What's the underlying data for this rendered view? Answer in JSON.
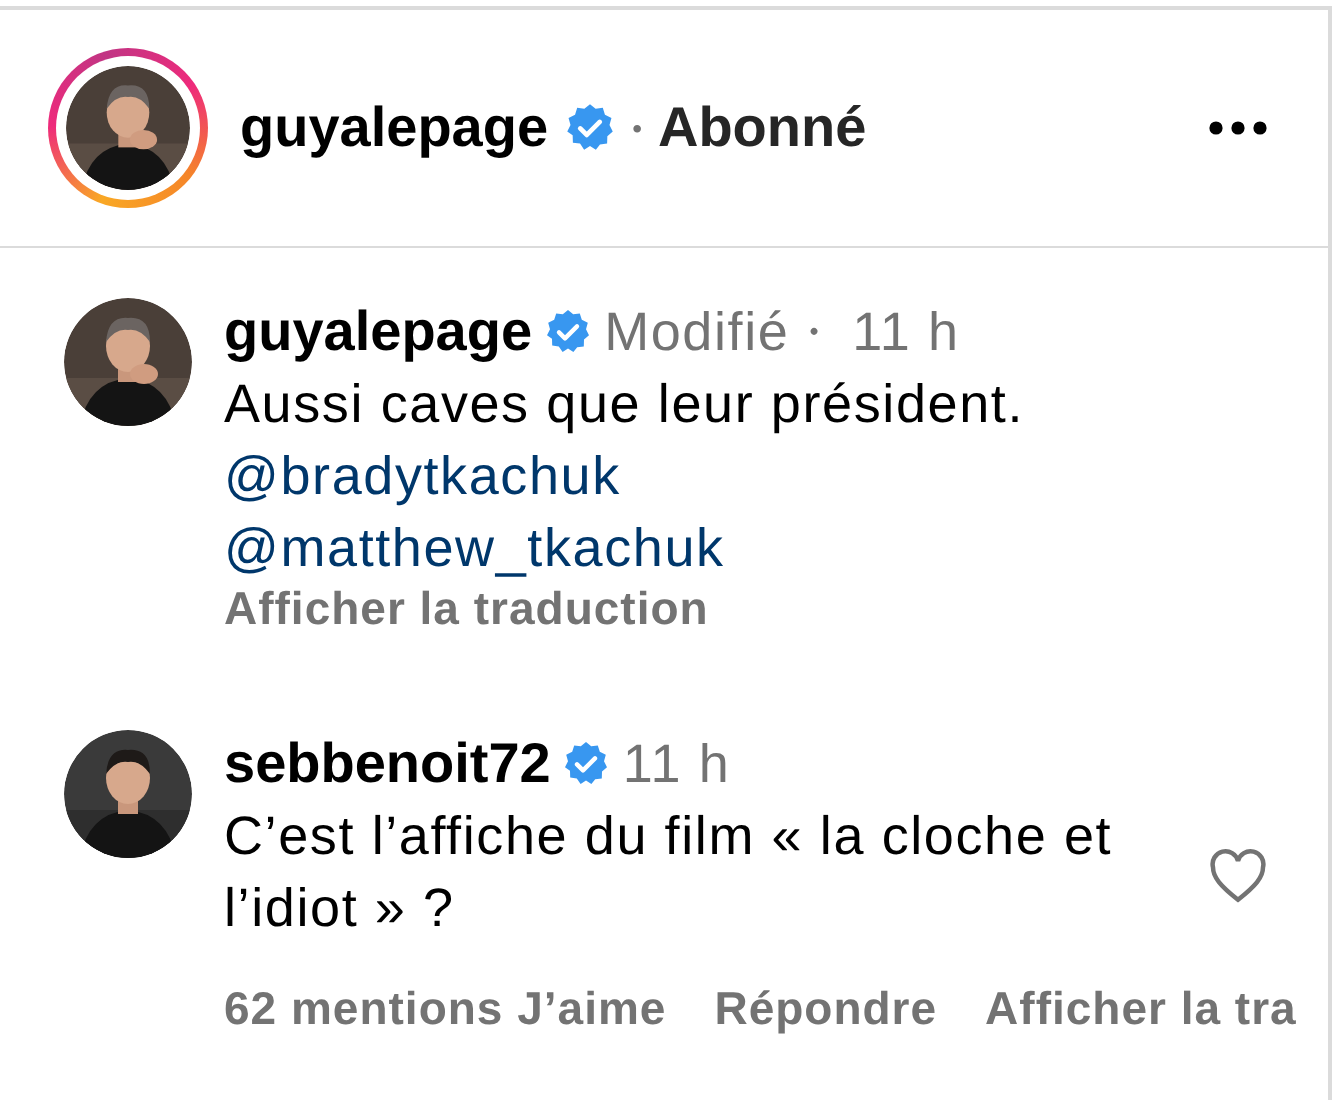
{
  "header": {
    "username": "guyalepage",
    "verified": true,
    "story_ring": true,
    "separator": "•",
    "follow_status": "Abonné"
  },
  "comments": [
    {
      "username": "guyalepage",
      "verified": true,
      "edited_label": "Modifié",
      "separator": "•",
      "time": "11 h",
      "text": "Aussi caves que leur président.",
      "mentions": [
        "@bradytkachuk",
        "@matthew_tkachuk"
      ],
      "translate_link": "Afficher la traduction"
    },
    {
      "username": "sebbenoit72",
      "verified": true,
      "time": "11 h",
      "text": "C’est l’affiche du film « la cloche et l’idiot » ?",
      "liked": false,
      "actions": [
        "62 mentions J’aime",
        "Répondre",
        "Afficher la tra"
      ]
    }
  ]
}
